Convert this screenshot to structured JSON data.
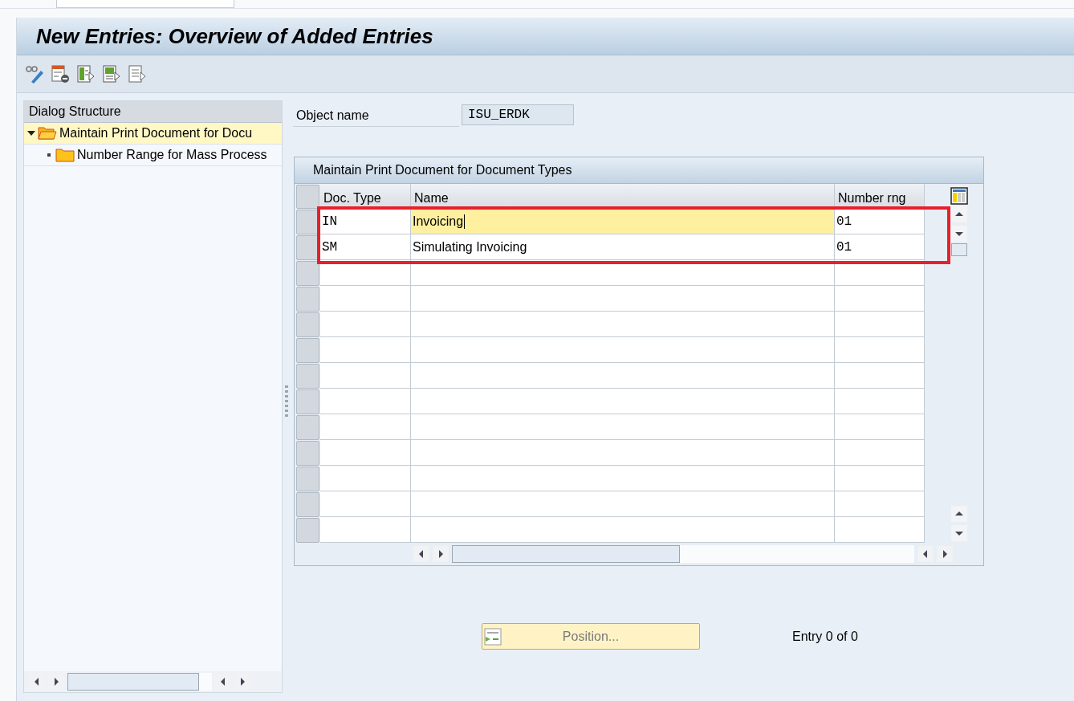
{
  "window": {
    "title": "New Entries: Overview of Added Entries"
  },
  "dialog_structure": {
    "title": "Dialog Structure",
    "items": [
      {
        "label": "Maintain Print Document for Docu",
        "expanded": true,
        "selected": true,
        "children": [
          {
            "label": "Number Range for Mass Process",
            "expanded": false,
            "selected": false
          }
        ]
      }
    ]
  },
  "object_name": {
    "label": "Object name",
    "value": "ISU_ERDK"
  },
  "table": {
    "title": "Maintain Print Document for Document Types",
    "columns": [
      "Doc. Type",
      "Name",
      "Number rng"
    ],
    "rows": [
      {
        "cells": [
          "IN",
          "Invoicing",
          "01"
        ],
        "focused": true,
        "highlighted": true
      },
      {
        "cells": [
          "SM",
          "Simulating Invoicing",
          "01"
        ],
        "focused": false,
        "highlighted": true
      }
    ]
  },
  "position_button": {
    "label": "Position..."
  },
  "entry_count": "Entry 0 of 0"
}
